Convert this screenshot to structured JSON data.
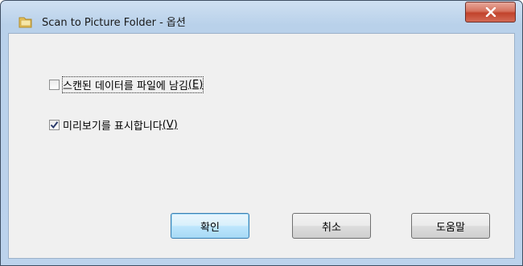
{
  "window": {
    "title": "Scan to Picture Folder - 옵션"
  },
  "options": [
    {
      "label_text": "스캔된 데이터를 파일에 남김",
      "mnemonic": "(E)",
      "checked": false,
      "focused": true
    },
    {
      "label_text": "미리보기를 표시합니다",
      "mnemonic": "(V)",
      "checked": true,
      "focused": false
    }
  ],
  "buttons": {
    "ok": "확인",
    "cancel": "취소",
    "help": "도움말"
  },
  "icons": {
    "title": "folder-icon",
    "close": "close-icon",
    "check": "checkmark-icon"
  }
}
